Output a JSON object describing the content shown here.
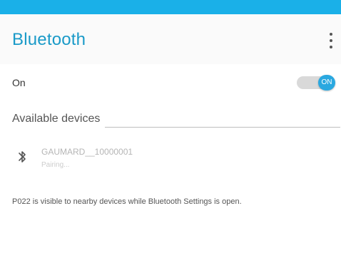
{
  "app_bar": {
    "title": "Bluetooth",
    "menu_icon": "more-vertical-icon"
  },
  "bluetooth_toggle": {
    "label": "On",
    "state_label": "ON",
    "state": true
  },
  "available_devices": {
    "header": "Available devices",
    "devices": [
      {
        "name": "GAUMARD__10000001",
        "status": "Pairing...",
        "icon": "bluetooth-icon"
      }
    ]
  },
  "visibility_message": "P022 is visible to nearby devices while Bluetooth Settings is open.",
  "colors": {
    "status_bar": "#1ab0e8",
    "accent": "#2aa8e0",
    "title": "#1a9ac8"
  }
}
